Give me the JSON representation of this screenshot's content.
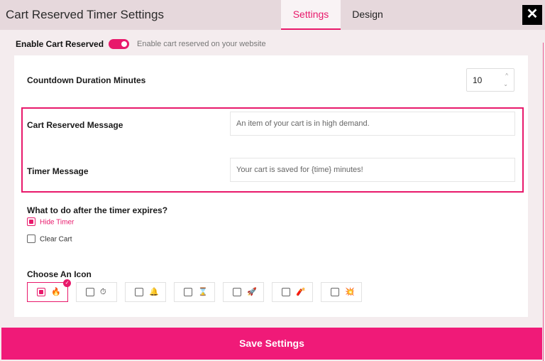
{
  "header": {
    "title": "Cart Reserved Timer Settings",
    "tabs": [
      {
        "label": "Settings",
        "active": true
      },
      {
        "label": "Design",
        "active": false
      }
    ],
    "close_icon": "close-icon"
  },
  "enable": {
    "label": "Enable Cart Reserved",
    "on": true,
    "description": "Enable cart reserved on your website"
  },
  "duration": {
    "label": "Countdown Duration Minutes",
    "value": "10"
  },
  "messages": {
    "cart_label": "Cart Reserved Message",
    "cart_placeholder": "An item of your cart is in high demand.",
    "timer_label": "Timer Message",
    "timer_placeholder": "Your cart is saved for {time} minutes!"
  },
  "expire": {
    "label": "What to do after the timer expires?",
    "options": [
      {
        "label": "Hide Timer",
        "checked": true
      },
      {
        "label": "Clear Cart",
        "checked": false
      }
    ]
  },
  "icon_choice": {
    "label": "Choose An Icon",
    "icons": [
      {
        "name": "fire-icon",
        "glyph": "🔥",
        "selected": true
      },
      {
        "name": "stopwatch-icon",
        "glyph": "⏱",
        "selected": false
      },
      {
        "name": "bell-icon",
        "glyph": "🔔",
        "selected": false
      },
      {
        "name": "hourglass-icon",
        "glyph": "⌛",
        "selected": false
      },
      {
        "name": "rocket-icon",
        "glyph": "🚀",
        "selected": false
      },
      {
        "name": "firecracker-icon",
        "glyph": "🧨",
        "selected": false
      },
      {
        "name": "explosion-icon",
        "glyph": "💥",
        "selected": false
      }
    ]
  },
  "save_label": "Save Settings",
  "colors": {
    "accent": "#e8196b",
    "save_button": "#f01a78"
  }
}
